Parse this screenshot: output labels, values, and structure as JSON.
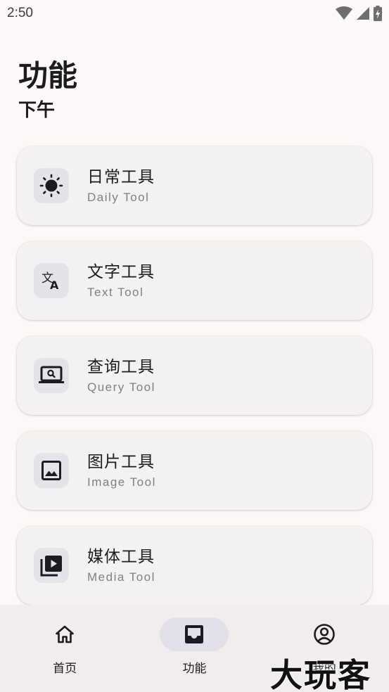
{
  "status_bar": {
    "time": "2:50",
    "icons": [
      "wifi-icon",
      "signal-icon",
      "battery-charging-icon"
    ]
  },
  "header": {
    "title": "功能",
    "subtitle": "下午"
  },
  "tools": [
    {
      "title": "日常工具",
      "subtitle": "Daily Tool",
      "icon": "brightness-icon"
    },
    {
      "title": "文字工具",
      "subtitle": "Text Tool",
      "icon": "translate-icon"
    },
    {
      "title": "查询工具",
      "subtitle": "Query Tool",
      "icon": "laptop-search-icon"
    },
    {
      "title": "图片工具",
      "subtitle": "Image Tool",
      "icon": "image-icon"
    },
    {
      "title": "媒体工具",
      "subtitle": "Media Tool",
      "icon": "video-library-icon"
    }
  ],
  "bottom_nav": {
    "items": [
      {
        "label": "首页",
        "icon": "home-icon",
        "active": false
      },
      {
        "label": "功能",
        "icon": "inbox-icon",
        "active": true
      },
      {
        "label": "我的",
        "icon": "account-circle-icon",
        "active": false
      }
    ]
  },
  "watermark": "大玩客",
  "colors": {
    "background": "#fcf8f7",
    "card": "#f4f2f1",
    "icon_tile": "#e6e3e8",
    "nav_bar": "#f0edec",
    "nav_active_pill": "#e2e0e8",
    "subtitle_text": "#807d86"
  }
}
